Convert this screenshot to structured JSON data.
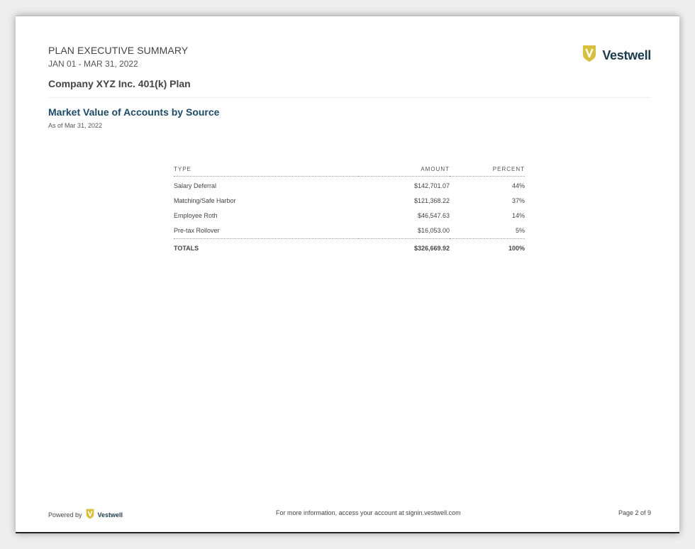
{
  "header": {
    "title": "PLAN EXECUTIVE SUMMARY",
    "period": "JAN 01 - MAR 31, 2022",
    "plan_name": "Company XYZ Inc. 401(k) Plan"
  },
  "logo": {
    "brand": "Vestwell",
    "icon": "shield-v-icon",
    "icon_color": "#d8bf3d",
    "text_color": "#1b3a4b"
  },
  "section": {
    "title": "Market Value of Accounts by Source",
    "subtitle": "As of Mar 31, 2022"
  },
  "table": {
    "headers": {
      "type": "TYPE",
      "amount": "AMOUNT",
      "percent": "PERCENT"
    },
    "rows": [
      {
        "type": "Salary Deferral",
        "amount": "$142,701.07",
        "percent": "44%"
      },
      {
        "type": "Matching/Safe Harbor",
        "amount": "$121,368.22",
        "percent": "37%"
      },
      {
        "type": "Employee Roth",
        "amount": "$46,547.63",
        "percent": "14%"
      },
      {
        "type": "Pre-tax Rollover",
        "amount": "$16,053.00",
        "percent": "5%"
      }
    ],
    "totals": {
      "label": "TOTALS",
      "amount": "$326,669.92",
      "percent": "100%"
    }
  },
  "footer": {
    "powered_by": "Powered by",
    "brand": "Vestwell",
    "info": "For more information, access your account at signin.vestwell.com",
    "page": "Page 2 of 9"
  }
}
